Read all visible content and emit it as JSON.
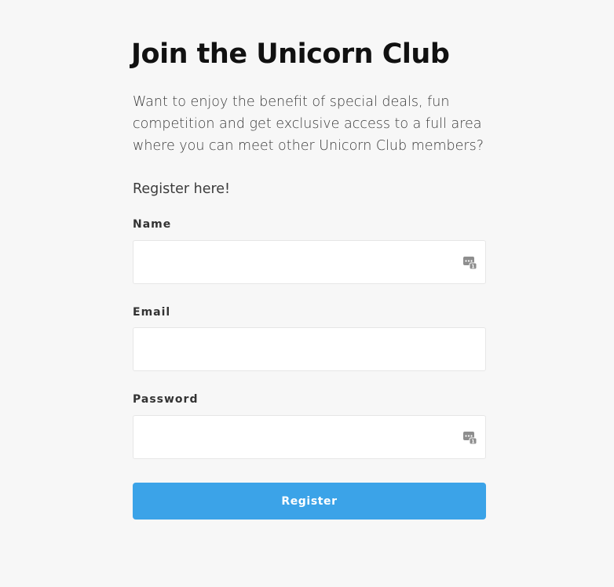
{
  "page": {
    "title": "Join the Unicorn Club",
    "intro": "Want to enjoy the benefit of special deals, fun competition and get exclusive access to a full area where you can meet other Unicorn Club members?",
    "register_prompt": "Register here!"
  },
  "form": {
    "name_label": "Name",
    "name_value": "",
    "email_label": "Email",
    "email_value": "",
    "password_label": "Password",
    "password_value": "",
    "submit_label": "Register"
  },
  "icons": {
    "password_manager": "password-manager-icon"
  },
  "colors": {
    "background": "#f7f7f7",
    "accent": "#3ba3e8",
    "text": "#1c1c1c"
  }
}
